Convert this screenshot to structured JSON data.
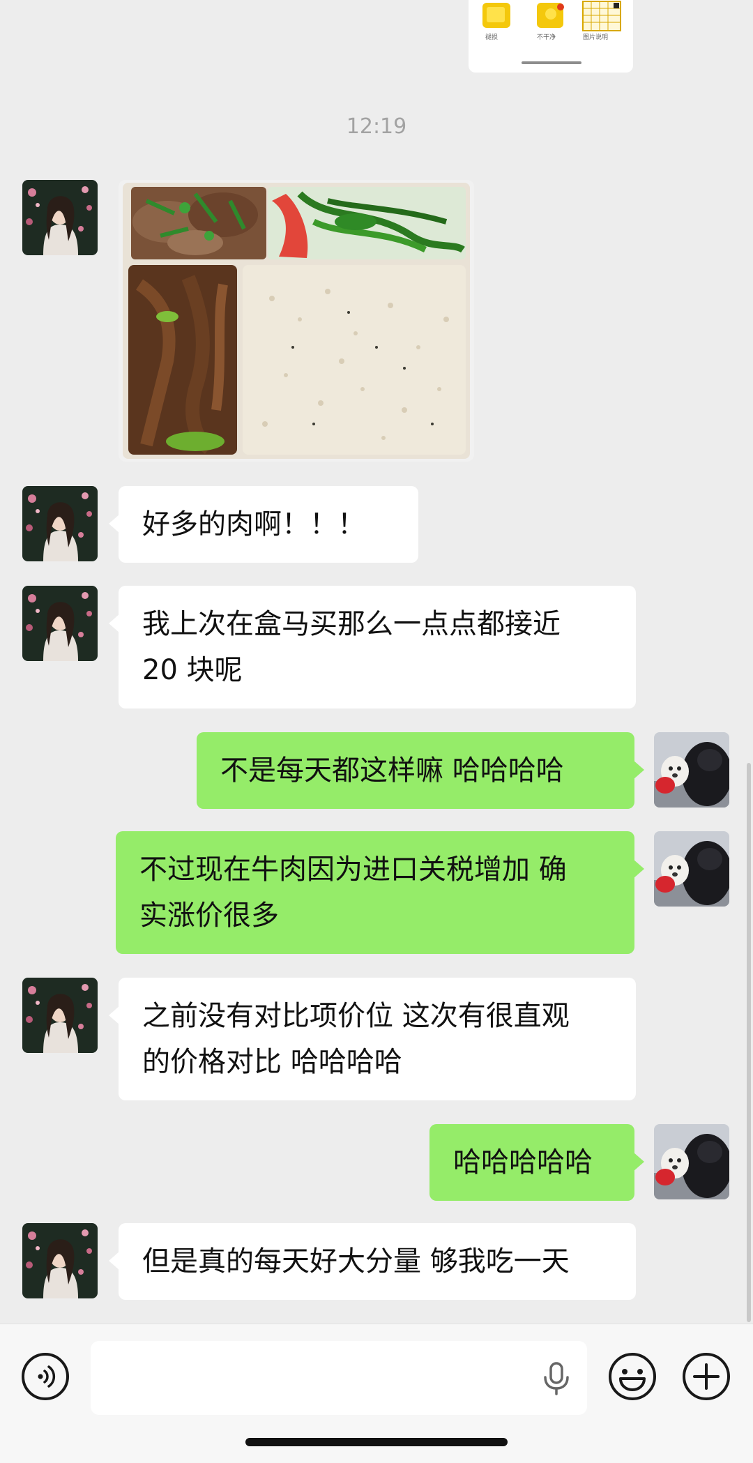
{
  "top_card": {
    "captions": [
      "褪损",
      "不干净",
      "图片说明"
    ]
  },
  "timestamp": "12:19",
  "messages": [
    {
      "side": "received",
      "type": "image",
      "alt": "lunch box photo"
    },
    {
      "side": "received",
      "type": "text",
      "lines": [
        "好多的肉啊！！！"
      ]
    },
    {
      "side": "received",
      "type": "text",
      "lines": [
        "我上次在盒马买那么一点点都接近",
        "20 块呢"
      ]
    },
    {
      "side": "sent",
      "type": "text",
      "lines": [
        "不是每天都这样嘛 哈哈哈哈"
      ]
    },
    {
      "side": "sent",
      "type": "text",
      "lines": [
        "不过现在牛肉因为进口关税增加 确",
        "实涨价很多"
      ]
    },
    {
      "side": "received",
      "type": "text",
      "lines": [
        "之前没有对比项价位 这次有很直观",
        "的价格对比 哈哈哈哈"
      ]
    },
    {
      "side": "sent",
      "type": "text",
      "lines": [
        "哈哈哈哈哈"
      ]
    },
    {
      "side": "received",
      "type": "text",
      "lines": [
        "但是真的每天好大分量 够我吃一天"
      ]
    }
  ],
  "input_bar": {
    "value": "",
    "voice_icon": "voice-toggle-icon",
    "mic_icon": "microphone-icon",
    "emoji_icon": "emoji-icon",
    "plus_icon": "plus-icon"
  },
  "colors": {
    "background": "#EDEDED",
    "sent_bubble": "#95EC69",
    "received_bubble": "#FFFFFF",
    "timestamp": "#A2A2A2"
  }
}
